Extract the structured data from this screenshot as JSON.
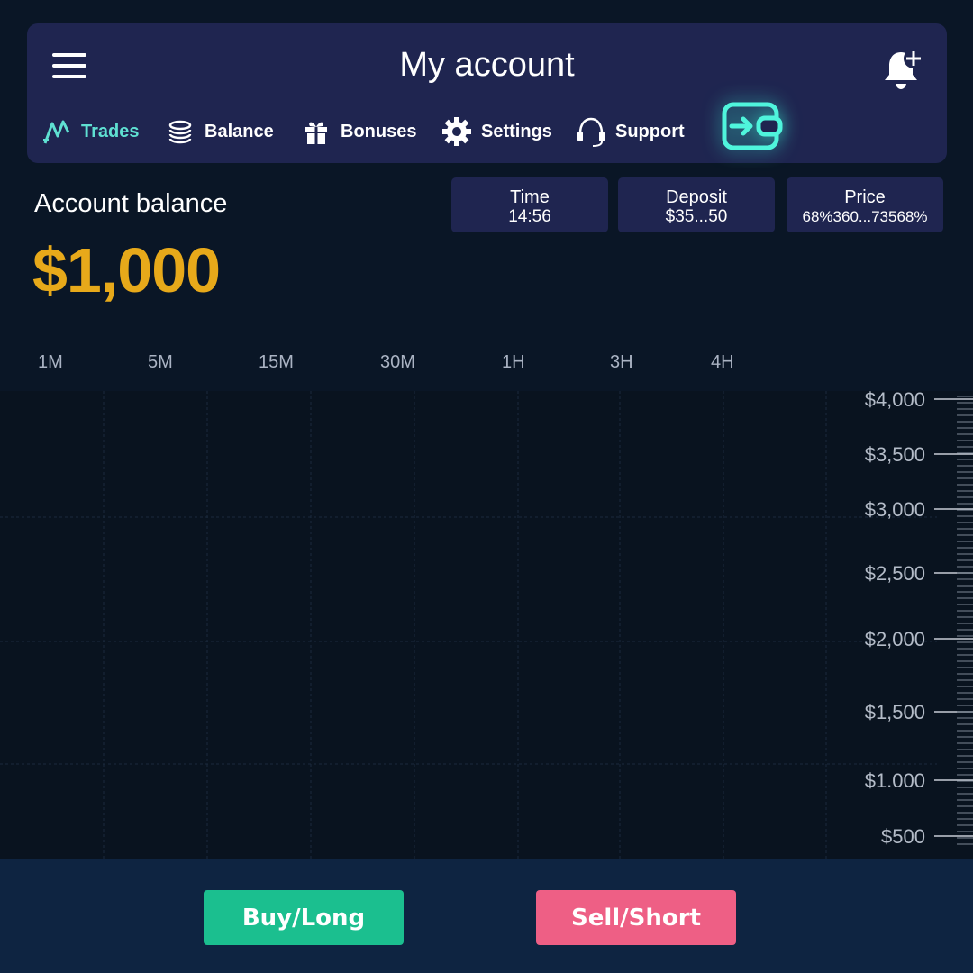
{
  "header": {
    "title": "My account",
    "nav": [
      {
        "label": "Trades",
        "icon": "trades-icon",
        "active": true
      },
      {
        "label": "Balance",
        "icon": "coins-icon"
      },
      {
        "label": "Bonuses",
        "icon": "gift-icon"
      },
      {
        "label": "Settings",
        "icon": "gear-icon"
      },
      {
        "label": "Support",
        "icon": "headset-icon"
      }
    ]
  },
  "account": {
    "label": "Account balance",
    "balance": "$1,000"
  },
  "stats": [
    {
      "label": "Time",
      "value": "14:56"
    },
    {
      "label": "Deposit",
      "value": "$35...50"
    },
    {
      "label": "Price",
      "value": "68%360...73568%"
    }
  ],
  "timeframes": [
    "1M",
    "5M",
    "15M",
    "30M",
    "1H",
    "3H",
    "4H"
  ],
  "chart_data": {
    "type": "line",
    "title": "",
    "xlabel": "",
    "ylabel": "",
    "y_tick_labels": [
      "$4,000",
      "$3,500",
      "$3,000",
      "$2,500",
      "$2,000",
      "$1,500",
      "$1.000",
      "$500"
    ],
    "y_tick_values": [
      4000,
      3500,
      3000,
      2500,
      2000,
      1500,
      1000,
      500
    ],
    "series": [],
    "grid": true
  },
  "actions": {
    "buy_label": "Buy/Long",
    "sell_label": "Sell/Short"
  },
  "colors": {
    "accent": "#5fe0d2",
    "balance": "#e7a91a",
    "buy": "#1bbf8f",
    "sell": "#ee5f85",
    "panel": "#1f2550"
  }
}
